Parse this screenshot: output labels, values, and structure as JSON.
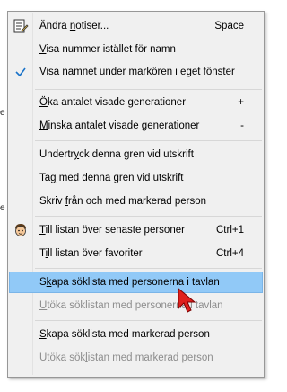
{
  "background": {
    "fragments": [
      "e",
      "e"
    ]
  },
  "menu": {
    "items": [
      {
        "before": "Ändra ",
        "key": "n",
        "after": "otiser...",
        "shortcut": "Space",
        "icon": "edit-notes-icon"
      },
      {
        "before": "",
        "key": "V",
        "after": "isa nummer istället för namn",
        "shortcut": ""
      },
      {
        "before": "Visa n",
        "key": "a",
        "after": "mnet under markören i eget fönster",
        "shortcut": "",
        "checked": true
      },
      {
        "before": "",
        "key": "Ö",
        "after": "ka antalet visade generationer",
        "shortcut": "+"
      },
      {
        "before": "",
        "key": "M",
        "after": "inska antalet visade generationer",
        "shortcut": "-"
      },
      {
        "before": "Undertr",
        "key": "y",
        "after": "ck denna gren vid utskrift",
        "shortcut": ""
      },
      {
        "before": "Ta",
        "key": "g",
        "after": " med denna gren vid utskrift",
        "shortcut": ""
      },
      {
        "before": "Skriv ",
        "key": "f",
        "after": "rån och med markerad person",
        "shortcut": ""
      },
      {
        "before": "",
        "key": "T",
        "after": "ill listan över senaste personer",
        "shortcut": "Ctrl+1",
        "icon": "person-face-icon"
      },
      {
        "before": "T",
        "key": "i",
        "after": "ll listan över favoriter",
        "shortcut": "Ctrl+4"
      },
      {
        "before": "S",
        "key": "k",
        "after": "apa söklista med personerna i tavlan",
        "shortcut": "",
        "highlighted": true
      },
      {
        "before": "",
        "key": "U",
        "after": "töka söklistan med personerna i tavlan",
        "shortcut": "",
        "disabled": true
      },
      {
        "before": "",
        "key": "S",
        "after": "kapa söklista med markerad person",
        "shortcut": ""
      },
      {
        "before": "Utöka sök",
        "key": "l",
        "after": "istan med markerad person",
        "shortcut": "",
        "disabled": true
      }
    ]
  },
  "colors": {
    "menu_bg": "#f0f0f0",
    "highlight": "#91c9f7",
    "disabled_text": "#8d8d8d",
    "cursor": "#e0201c",
    "checkmark": "#1a73c9"
  }
}
